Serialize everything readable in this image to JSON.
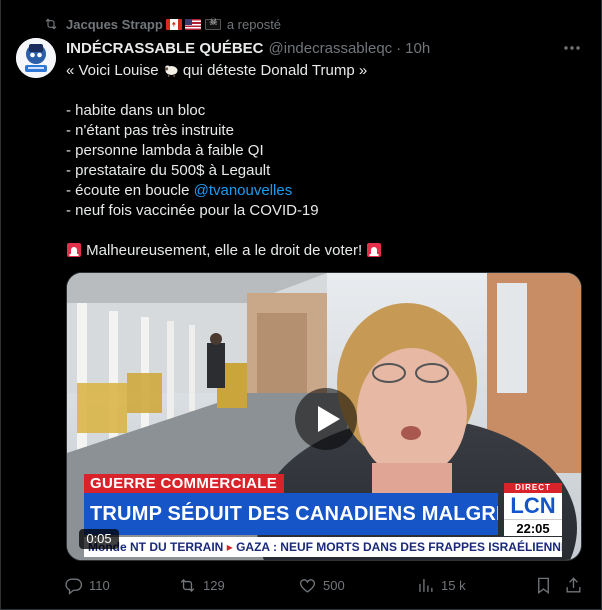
{
  "repost": {
    "user": "Jacques Strapp",
    "label": "a reposté"
  },
  "tweet": {
    "author_name": "INDÉCRASSABLE QUÉBEC",
    "handle": "@indecrassableqc",
    "separator": "·",
    "time": "10h",
    "lines": {
      "l1a": "« Voici Louise ",
      "l1b": " qui déteste Donald Trump »",
      "l2": "- habite dans un bloc",
      "l3": "- n'étant pas très instruite",
      "l4": "- personne lambda à faible QI",
      "l5": "- prestataire du 500$ à Legault",
      "l6a": "- écoute en boucle ",
      "l6_link": "@tvanouvelles",
      "l7": "- neuf fois vaccinée pour la COVID-19",
      "l8": " Malheureusement, elle a le droit de voter! "
    }
  },
  "video": {
    "banner_top": "GUERRE COMMERCIALE",
    "banner_main": "TRUMP SÉDUIT DES CANADIENS MALGRÉ LES TARIFS",
    "channel_direct": "DIRECT",
    "channel_logo": "LCN",
    "channel_time": "22:05",
    "ticker_a": "Monde",
    "ticker_b": "NT DU TERRAIN",
    "ticker_sep": "▸",
    "ticker_c": "GAZA : NEUF MORTS DANS DES FRAPPES ISRAÉLIENNES",
    "timecode": "0:05"
  },
  "actions": {
    "replies": "110",
    "reposts": "129",
    "likes": "500",
    "views": "15 k"
  },
  "colors": {
    "background": "#000000",
    "text": "#e7e9ea",
    "muted": "#71767b",
    "link": "#1d9bf0",
    "lcn_red": "#d8232a",
    "lcn_blue": "#1655c8"
  },
  "icons": {
    "repost": "repost-icon",
    "more": "more-icon",
    "play": "play-icon",
    "reply": "reply-icon",
    "retweet": "retweet-icon",
    "like": "heart-icon",
    "views": "views-icon",
    "bookmark": "bookmark-icon",
    "share": "share-icon",
    "sheep": "sheep-emoji-icon",
    "siren": "siren-emoji-icon"
  }
}
